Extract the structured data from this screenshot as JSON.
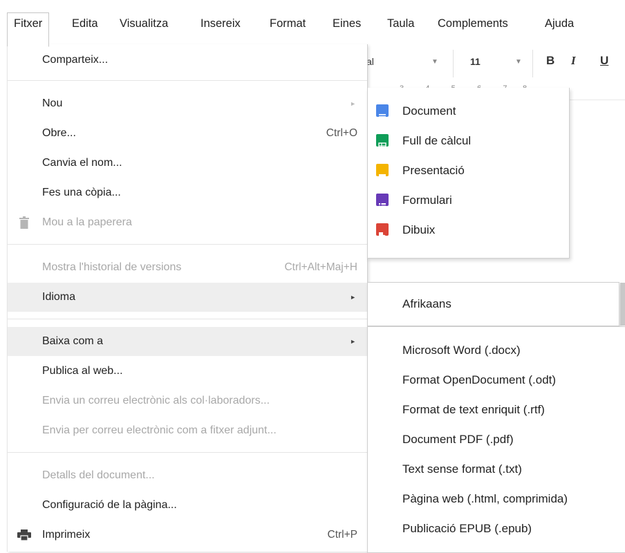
{
  "menubar": {
    "items": [
      "Fitxer",
      "Edita",
      "Visualitza",
      "Insereix",
      "Format",
      "Eines",
      "Taula",
      "Complements",
      "Ajuda"
    ]
  },
  "toolbar": {
    "font_fragment": "al",
    "font_size": "11",
    "bold": "B",
    "italic": "I",
    "underline": "U"
  },
  "ruler": {
    "text": "3 · · · 4 · · · 5 · · · 6 · · · 7 · · 8"
  },
  "file_menu": {
    "share": "Comparteix...",
    "new": "Nou",
    "open": "Obre...",
    "open_shortcut": "Ctrl+O",
    "rename": "Canvia el nom...",
    "copy": "Fes una còpia...",
    "trash": "Mou a la paperera",
    "history": "Mostra l'historial de versions",
    "history_shortcut": "Ctrl+Alt+Maj+H",
    "language": "Idioma",
    "download": "Baixa com a",
    "publish": "Publica al web...",
    "email_collab": "Envia un correu electrònic als col·laboradors...",
    "email_attach": "Envia per correu electrònic com a fitxer adjunt...",
    "details": "Detalls del document...",
    "page_setup": "Configuració de la pàgina...",
    "print": "Imprimeix",
    "print_shortcut": "Ctrl+P"
  },
  "new_submenu": {
    "items": [
      "Document",
      "Full de càlcul",
      "Presentació",
      "Formulari",
      "Dibuix"
    ],
    "colors": [
      "#4a86e8",
      "#0f9d58",
      "#f4b400",
      "#673ab7",
      "#db4437"
    ]
  },
  "language_submenu": {
    "items": [
      "Afrikaans"
    ]
  },
  "download_submenu": {
    "items": [
      "Microsoft Word (.docx)",
      "Format OpenDocument (.odt)",
      "Format de text enriquit (.rtf)",
      "Document PDF (.pdf)",
      "Text sense format (.txt)",
      "Pàgina web (.html, comprimida)",
      "Publicació EPUB (.epub)"
    ]
  }
}
